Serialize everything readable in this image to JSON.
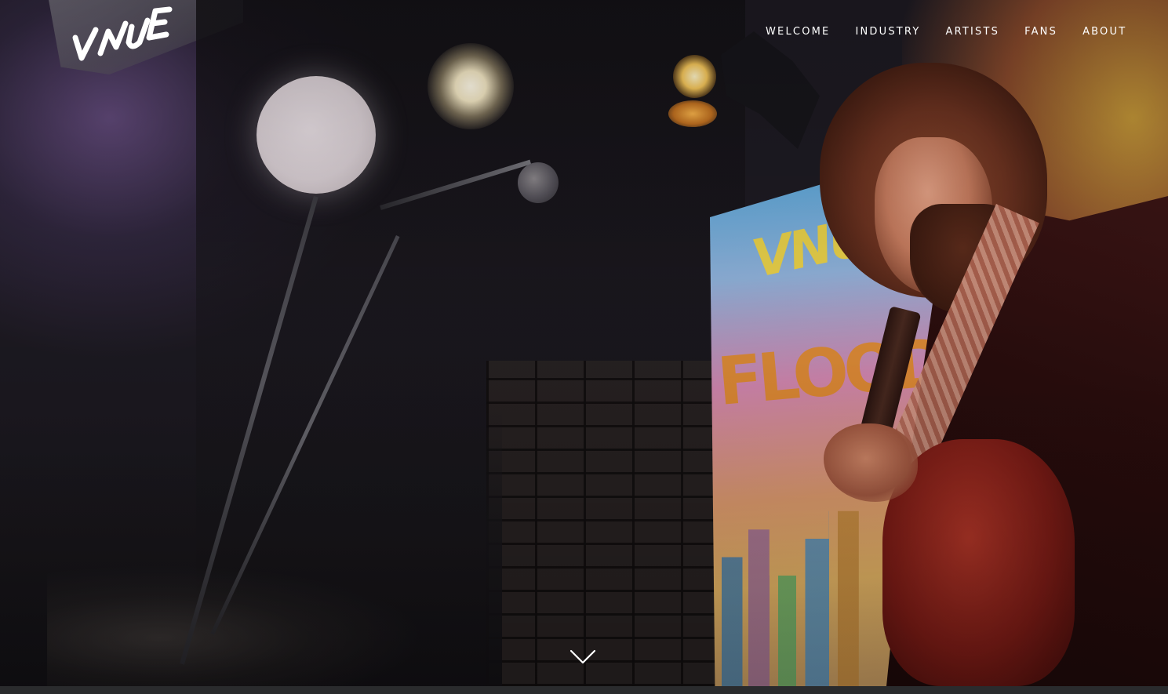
{
  "brand": {
    "logo_text": "VNUE"
  },
  "nav": {
    "items": [
      {
        "label": "WELCOME"
      },
      {
        "label": "INDUSTRY"
      },
      {
        "label": "ARTISTS"
      },
      {
        "label": "FANS"
      },
      {
        "label": "ABOUT"
      }
    ]
  },
  "hero": {
    "scroll_icon": "chevron-down-icon"
  },
  "colors": {
    "nav_text": "#ffffff",
    "bottom_strip": "#2a2b2d",
    "banner_yellow": "#f1d23a",
    "banner_orange": "#e78f2a"
  }
}
